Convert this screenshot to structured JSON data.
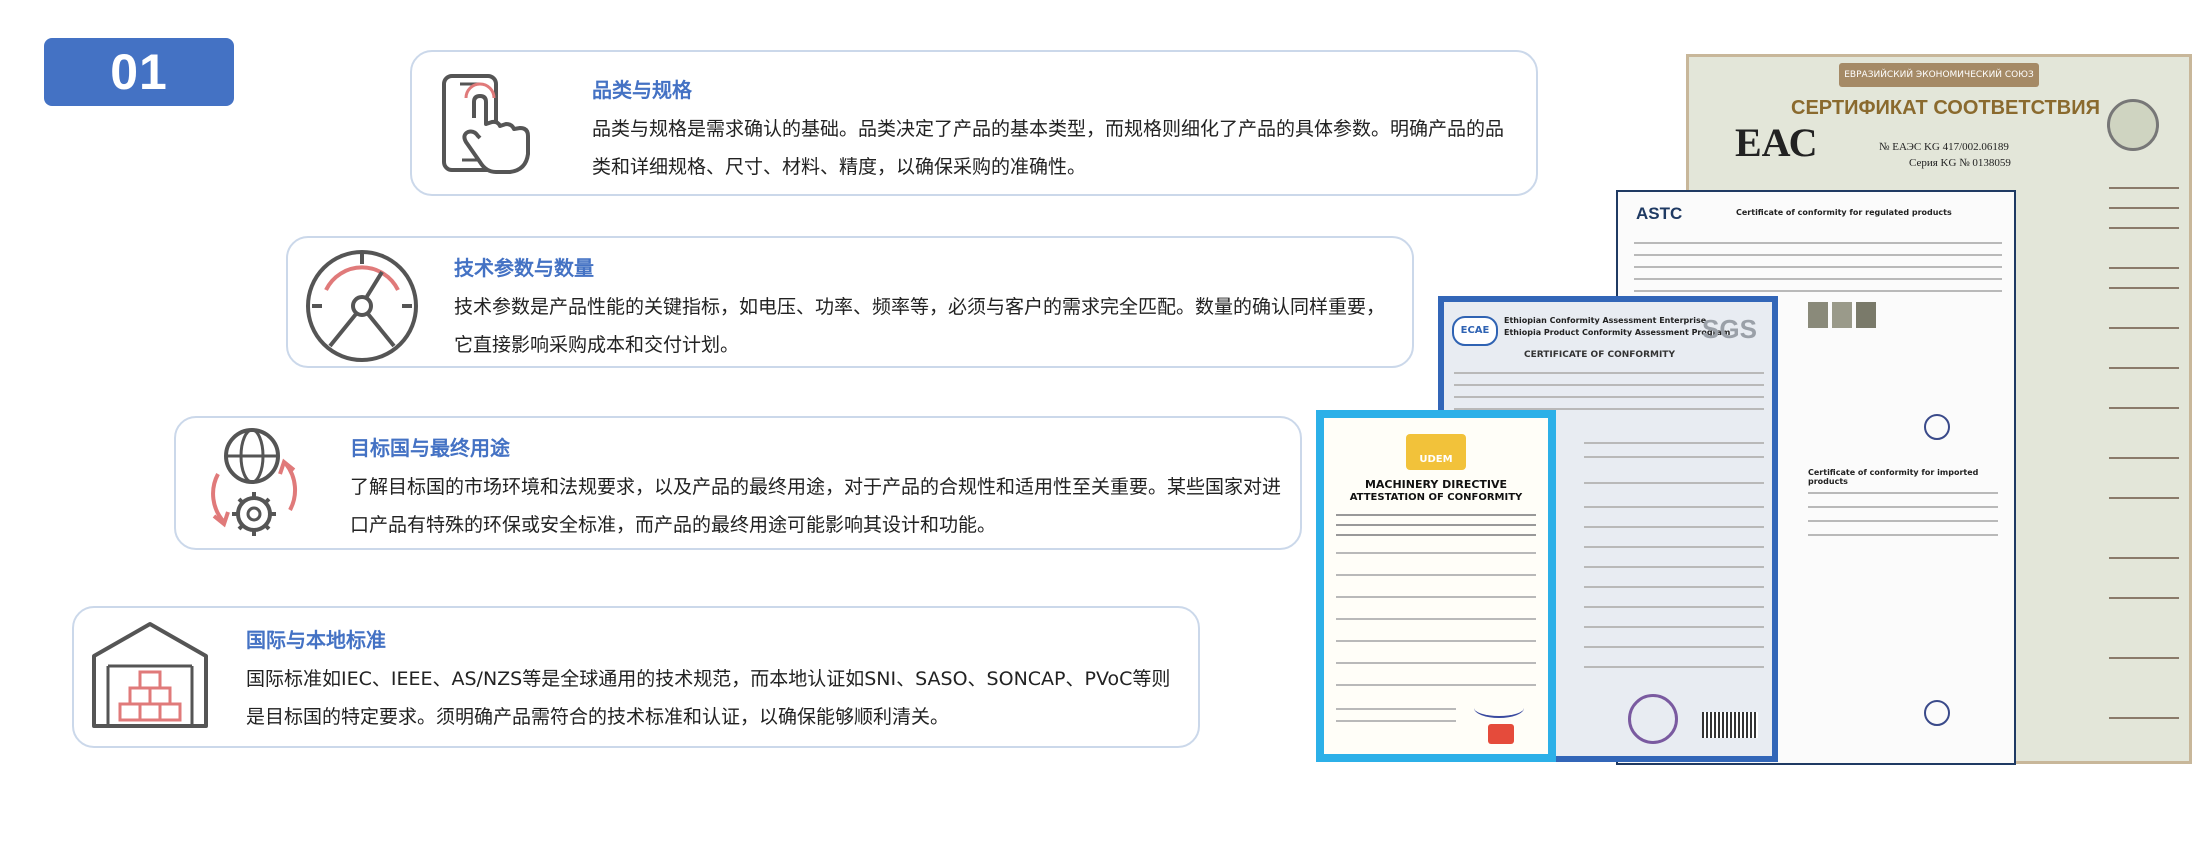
{
  "section_number": "01",
  "items": [
    {
      "title": "品类与规格",
      "text": "品类与规格是需求确认的基础。品类决定了产品的基本类型，而规格则细化了产品的具体参数。明确产品的品类和详细规格、尺寸、材料、精度，以确保采购的准确性。",
      "icon": "hand-tapping-phone-icon"
    },
    {
      "title": "技术参数与数量",
      "text": "技术参数是产品性能的关键指标，如电压、功率、频率等，必须与客户的需求完全匹配。数量的确认同样重要，它直接影响采购成本和交付计划。",
      "icon": "gauge-icon"
    },
    {
      "title": "目标国与最终用途",
      "text": "了解目标国的市场环境和法规要求，以及产品的最终用途，对于产品的合规性和适用性至关重要。某些国家对进口产品有特殊的环保或安全标准，而产品的最终用途可能影响其设计和功能。",
      "icon": "globe-gear-cycle-icon"
    },
    {
      "title": "国际与本地标准",
      "text": "国际标准如IEC、IEEE、AS/NZS等是全球通用的技术规范，而本地认证如SNI、SASO、SONCAP、PVoC等则是目标国的特定要求。须明确产品需符合的技术标准和认证，以确保能够顺利清关。",
      "icon": "warehouse-boxes-icon"
    }
  ],
  "certificates": {
    "eac": {
      "union_text": "ЕВРАЗИЙСКИЙ ЭКОНОМИЧЕСКИЙ СОЮЗ",
      "title": "СЕРТИФИКАТ СООТВЕТСТВИЯ",
      "logo": "ЕАС",
      "number": "№ ЕАЭС KG 417/002.06189",
      "series": "Серия KG № 0138059"
    },
    "astc": {
      "logo": "ASTC",
      "title": "Certificate of conformity for regulated products",
      "title2": "Certificate of conformity for imported products"
    },
    "ecae": {
      "logo": "ECAE",
      "org1": "Ethiopian Conformity Assessment Enterprise",
      "org2": "Ethiopia Product Conformity Assessment Program",
      "title": "CERTIFICATE OF CONFORMITY",
      "sgs": "SGS"
    },
    "udem": {
      "logo": "UDEM",
      "title1": "MACHINERY DIRECTIVE",
      "title2": "ATTESTATION OF CONFORMITY"
    }
  }
}
